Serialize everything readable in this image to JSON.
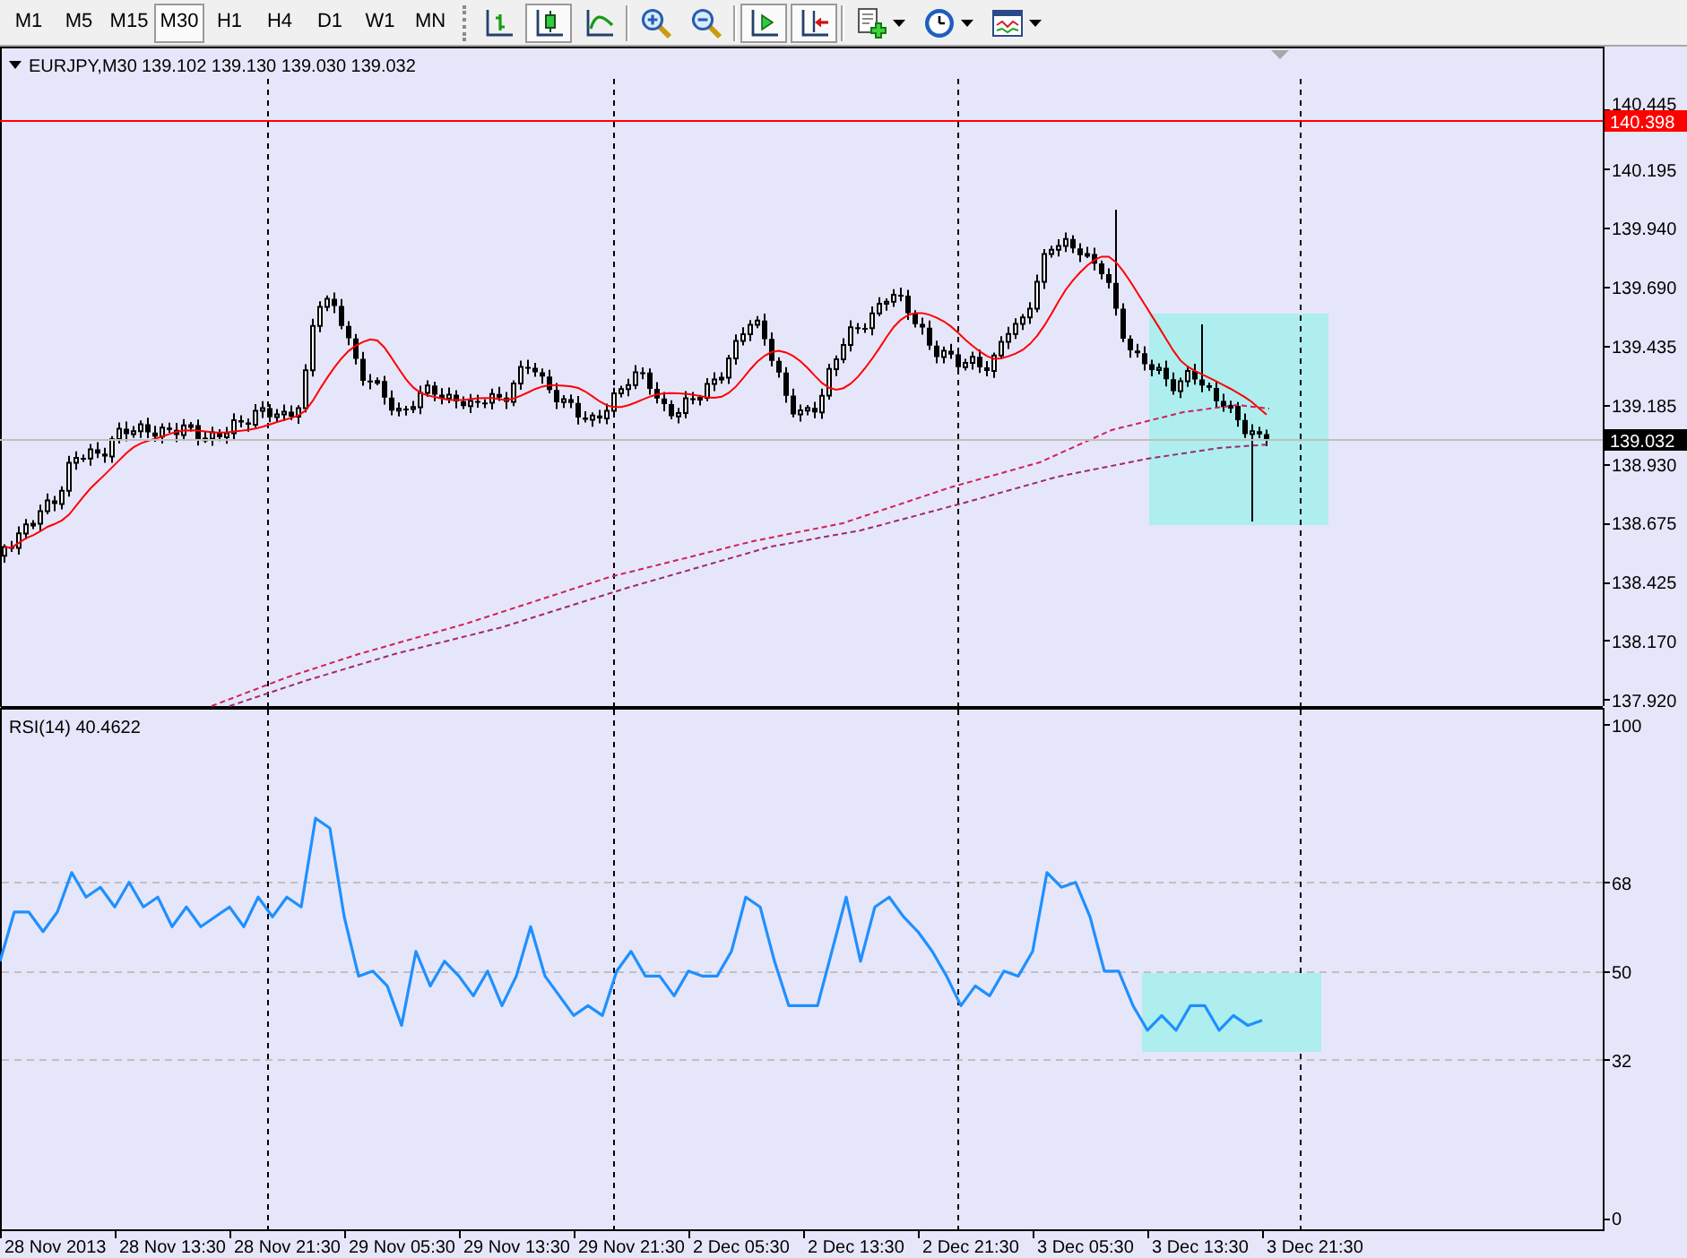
{
  "toolbar": {
    "timeframes": [
      {
        "label": "M1",
        "selected": false
      },
      {
        "label": "M5",
        "selected": false
      },
      {
        "label": "M15",
        "selected": false
      },
      {
        "label": "M30",
        "selected": true
      },
      {
        "label": "H1",
        "selected": false
      },
      {
        "label": "H4",
        "selected": false
      },
      {
        "label": "D1",
        "selected": false
      },
      {
        "label": "W1",
        "selected": false
      },
      {
        "label": "MN",
        "selected": false
      }
    ],
    "tool_groups": [
      {
        "tools": [
          {
            "kind": "bars",
            "on": false
          },
          {
            "kind": "candles",
            "on": true
          },
          {
            "kind": "line",
            "on": false
          }
        ]
      },
      {
        "tools": [
          {
            "kind": "zoomin",
            "on": false
          },
          {
            "kind": "zoomout",
            "on": false
          }
        ]
      },
      {
        "tools": [
          {
            "kind": "shift",
            "on": true
          },
          {
            "kind": "autoscroll",
            "on": true
          }
        ]
      },
      {
        "tools": [
          {
            "kind": "indicators",
            "on": false
          },
          {
            "kind": "periods",
            "on": false
          },
          {
            "kind": "templates",
            "on": false
          }
        ]
      }
    ]
  },
  "price_chart": {
    "symbol": "EURJPY,M30",
    "ohlc": "139.102 139.130 139.030 139.032",
    "price_axis": [
      "140.445",
      "140.195",
      "139.940",
      "139.690",
      "139.435",
      "139.185",
      "138.930",
      "138.675",
      "138.425",
      "138.170",
      "137.920"
    ],
    "level_label": "140.398",
    "bid_label": "139.032"
  },
  "rsi_panel": {
    "label": "RSI(14) 40.4622",
    "chart_data": {
      "type": "line",
      "values": [
        52,
        62,
        62,
        58,
        62,
        70,
        65,
        67,
        63,
        68,
        63,
        65,
        59,
        63,
        59,
        61,
        63,
        59,
        65,
        61,
        65,
        63,
        81,
        79,
        61,
        49,
        50,
        47,
        39,
        54,
        47,
        52,
        49,
        45,
        50,
        43,
        49,
        59,
        49,
        45,
        41,
        43,
        41,
        50,
        54,
        49,
        49,
        45,
        50,
        49,
        49,
        54,
        65,
        63,
        52,
        43,
        43,
        43,
        54,
        65,
        52,
        63,
        65,
        61,
        58,
        54,
        49,
        43,
        47,
        45,
        50,
        49,
        54,
        70,
        67,
        68,
        61,
        50,
        50,
        43,
        38,
        41,
        38,
        43,
        43,
        38,
        41,
        39,
        40
      ],
      "ylim": [
        -2.7,
        103
      ],
      "yticks": [
        0,
        32,
        50,
        68,
        100
      ],
      "grid": true
    },
    "time_axis": [
      "28 Nov 2013",
      "28 Nov 13:30",
      "28 Nov 21:30",
      "29 Nov 05:30",
      "29 Nov 13:30",
      "29 Nov 21:30",
      "2 Dec 05:30",
      "2 Dec 13:30",
      "2 Dec 21:30",
      "3 Dec 05:30",
      "3 Dec 13:30",
      "3 Dec 21:30"
    ]
  }
}
